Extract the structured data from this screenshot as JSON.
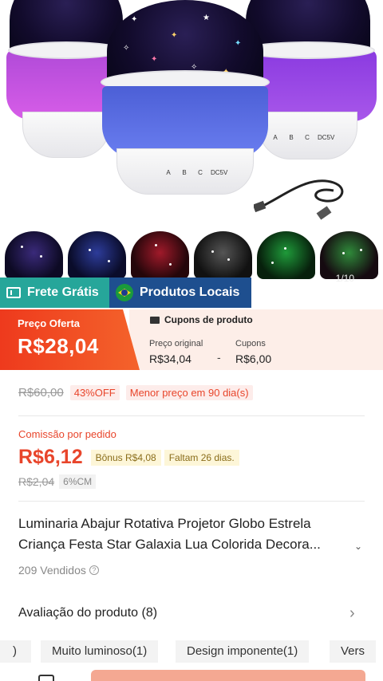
{
  "gallery": {
    "counter": "1/10",
    "lamp_labels": [
      "A",
      "B",
      "C",
      "DC5V"
    ]
  },
  "badges": {
    "frete": "Frete Grátis",
    "local": "Produtos Locais"
  },
  "offer": {
    "label": "Preço Oferta",
    "price": "R$28,04",
    "coupons_title": "Cupons de produto",
    "original_label": "Preço original",
    "original_value": "R$34,04",
    "minus": "-",
    "coupons_label": "Cupons",
    "coupons_value": "R$6,00"
  },
  "old_price": {
    "value": "R$60,00",
    "discount": "43%OFF",
    "lowest": "Menor preço em 90 dia(s)"
  },
  "commission": {
    "label": "Comissão por pedido",
    "value": "R$6,12",
    "bonus": "Bônus R$4,08",
    "days": "Faltam 26 dias.",
    "old": "R$2,04",
    "rate": "6%CM"
  },
  "product": {
    "title": "Luminaria Abajur Rotativa Projetor Globo Estrela Criança Festa Star Galaxia Lua Colorida Decora...",
    "sold": "209 Vendidos",
    "help_glyph": "?",
    "expand_glyph": "⌄"
  },
  "reviews": {
    "label": "Avaliação do produto (8)",
    "chevron": "›"
  },
  "tags": [
    ")",
    "Muito luminoso(1)",
    "Design imponente(1)",
    "Vers"
  ],
  "colors": {
    "accent": "#e8452b",
    "frete": "#26a69a",
    "local": "#1e4f8f"
  }
}
